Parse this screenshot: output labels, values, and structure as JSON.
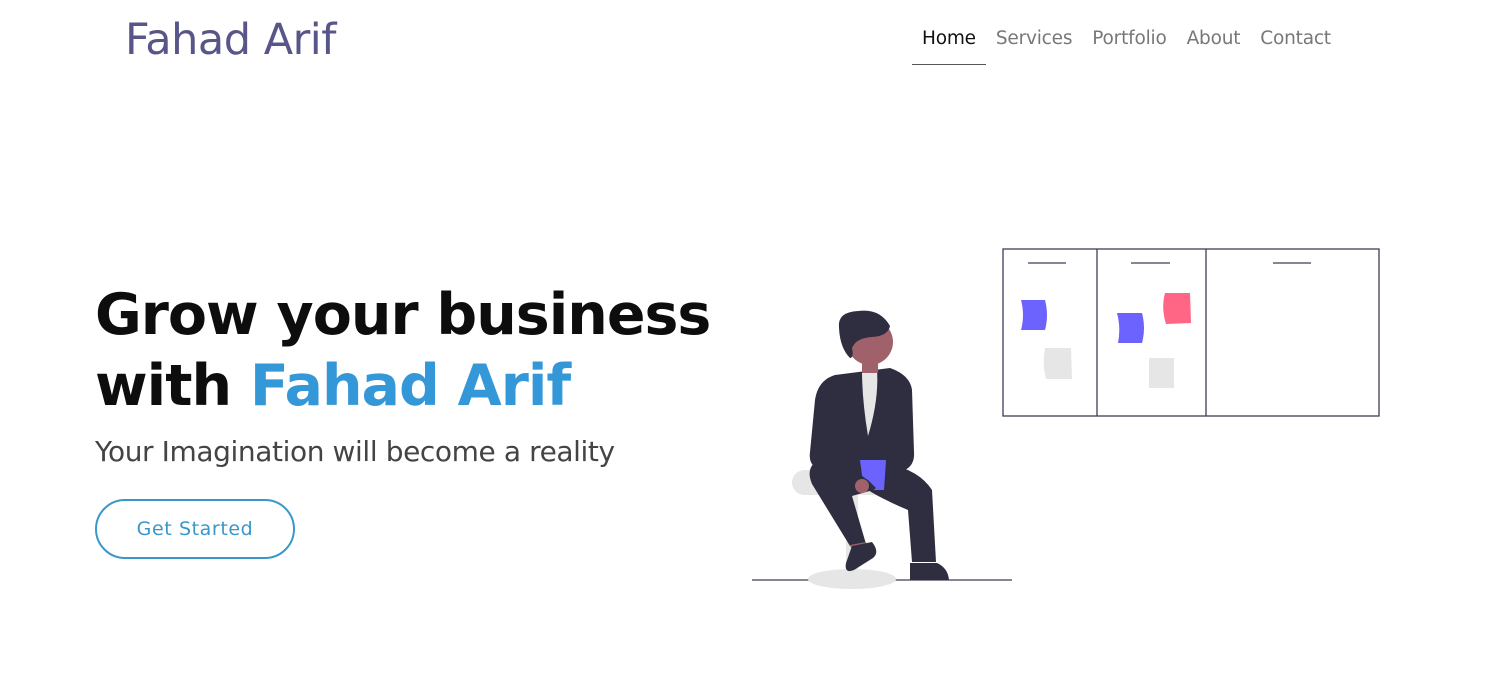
{
  "header": {
    "brand": "Fahad Arif",
    "nav": [
      {
        "label": "Home",
        "active": true
      },
      {
        "label": "Services",
        "active": false
      },
      {
        "label": "Portfolio",
        "active": false
      },
      {
        "label": "About",
        "active": false
      },
      {
        "label": "Contact",
        "active": false
      }
    ]
  },
  "hero": {
    "title_line1": "Grow your business",
    "title_prefix": "with",
    "title_highlight": "Fahad Arif",
    "subtitle": "Your Imagination will become a reality",
    "cta_label": "Get Started"
  },
  "colors": {
    "brand": "#585688",
    "accent": "#3498d8",
    "heading": "#0d0d0d",
    "subtitle": "#444444",
    "nav_active": "#111111",
    "nav_inactive": "#777777",
    "cta_border": "#3a97c9",
    "sticky_purple": "#6c63ff",
    "sticky_pink": "#ff6584",
    "sticky_gray": "#e6e6e6",
    "figure_dark": "#2f2e41",
    "skin": "#a0616a"
  }
}
